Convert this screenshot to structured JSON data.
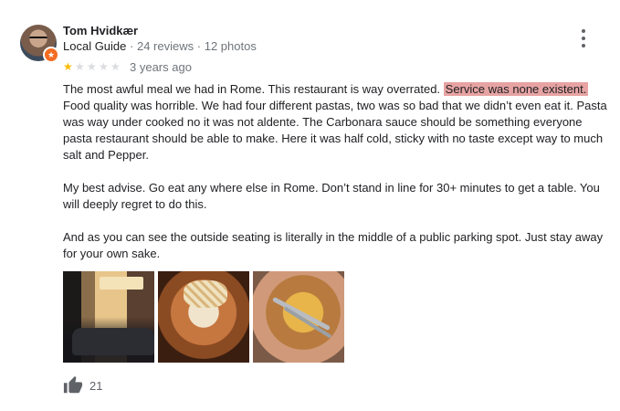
{
  "reviewer": {
    "name": "Tom Hvidkær",
    "badge": "Local Guide",
    "reviews": "24 reviews",
    "photos": "12 photos",
    "separator": "·"
  },
  "rating": {
    "stars": 1,
    "max": 5,
    "time": "3 years ago"
  },
  "review": {
    "p1_before": "The most awful meal we had in Rome. This restaurant is way overrated. ",
    "p1_highlight": "Service was none existent.",
    "p1_after": " Food quality was horrible. We had four different pastas, two was so bad that we didn’t even eat it. Pasta was way under cooked no it was not aldente. The Carbonara sauce should be something everyone pasta restaurant should be able to make. Here it was half cold, sticky with no taste except way to much salt and Pepper.",
    "p2": "My best advise. Go eat any where else in Rome. Don’t stand in line for 30+ minutes to get a table. You will deeply regret to do this.",
    "p3": "And as you can see the outside seating is literally in the middle of a public parking spot. Just stay away for your own sake.",
    "highlight_color": "#e7a3a3"
  },
  "photos": [
    "photo-outdoor-seating",
    "photo-pasta-bowl",
    "photo-carbonara-plate"
  ],
  "likes": {
    "count": "21",
    "icon": "thumbs-up-icon"
  },
  "colors": {
    "star": "#fbbc04",
    "star_off": "#dadce0",
    "guide_badge": "#f36c21",
    "muted": "#70757a"
  }
}
